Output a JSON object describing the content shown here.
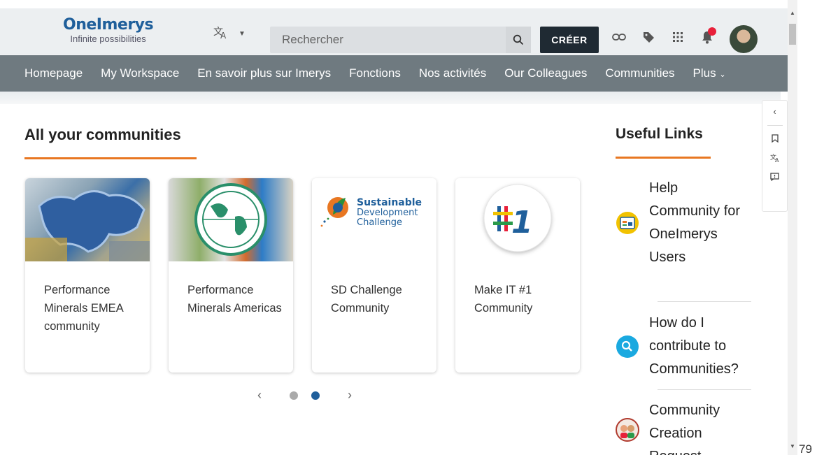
{
  "header": {
    "brand": "OneImerys",
    "tagline": "Infinite possibilities",
    "search_placeholder": "Rechercher",
    "create_label": "CRÉER"
  },
  "nav": {
    "items": [
      "Homepage",
      "My Workspace",
      "En savoir plus sur Imerys",
      "Fonctions",
      "Nos activités",
      "Our Colleagues",
      "Communities"
    ],
    "more_label": "Plus"
  },
  "main": {
    "section_title": "All your communities",
    "cards": [
      {
        "title": "Performance Minerals EMEA community"
      },
      {
        "title": "Performance Minerals Americas"
      },
      {
        "title": "SD Challenge Community",
        "logo_lines": [
          "Sustainable",
          "Development",
          "Challenge"
        ]
      },
      {
        "title": "Make IT #1 Community",
        "badge": "#1"
      }
    ],
    "pager": {
      "pages": 2,
      "current": 2
    }
  },
  "useful_links": {
    "title": "Useful Links",
    "items": [
      {
        "label": "Help Community for OneImerys Users",
        "icon": "screen-icon"
      },
      {
        "label": "How do I contribute to Communities?",
        "icon": "search-icon"
      },
      {
        "label": "Community Creation Request",
        "icon": "people-icon"
      }
    ]
  },
  "page_number": "79",
  "colors": {
    "accent": "#e87722",
    "brand": "#1f5f9b",
    "nav_bg": "#6f7a80",
    "create_bg": "#1f2a33"
  }
}
